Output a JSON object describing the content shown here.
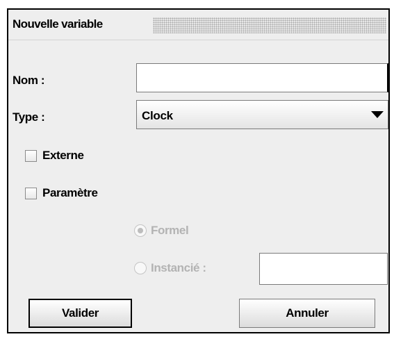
{
  "dialog": {
    "title": "Nouvelle variable"
  },
  "form": {
    "name_label": "Nom :",
    "name_value": "",
    "type_label": "Type :",
    "type_value": "Clock",
    "external_label": "Externe",
    "external_checked": false,
    "parameter_label": "Paramètre",
    "parameter_checked": false,
    "formal_label": "Formel",
    "formal_selected": true,
    "instantiated_label": "Instancié :",
    "instantiated_value": ""
  },
  "buttons": {
    "validate_label": "Valider",
    "cancel_label": "Annuler"
  },
  "icons": {
    "dropdown": "chevron-down-icon",
    "grip": "drag-grip-icon"
  }
}
